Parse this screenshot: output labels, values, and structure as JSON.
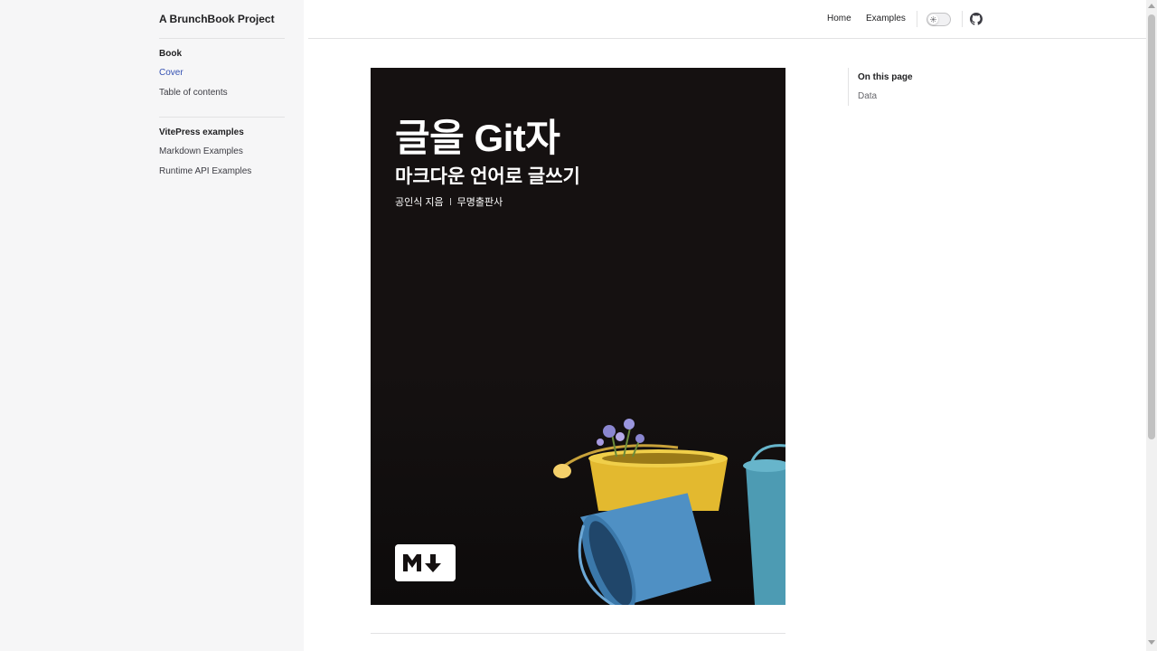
{
  "sidebar": {
    "brand": "A BrunchBook Project",
    "groups": [
      {
        "title": "Book",
        "items": [
          {
            "label": "Cover",
            "active": true
          },
          {
            "label": "Table of contents"
          }
        ]
      },
      {
        "title": "VitePress examples",
        "items": [
          {
            "label": "Markdown Examples"
          },
          {
            "label": "Runtime API Examples"
          }
        ]
      }
    ]
  },
  "topnav": {
    "links": [
      "Home",
      "Examples"
    ],
    "theme_toggle_icon": "sun-icon",
    "social_icon": "github-icon"
  },
  "cover": {
    "title": "글을 Git자",
    "subtitle": "마크다운 언어로 글쓰기",
    "author": "공인식 지음",
    "publisher": "무명출판사",
    "logo_icon": "markdown-logo-icon",
    "illustration": "buckets-and-flowers-photo"
  },
  "aside": {
    "title": "On this page",
    "links": [
      "Data"
    ]
  },
  "colors": {
    "accent": "#3451b2",
    "sidebar_bg": "#f6f6f7",
    "cover_bg": "#151111",
    "text": "#3c3c43"
  }
}
